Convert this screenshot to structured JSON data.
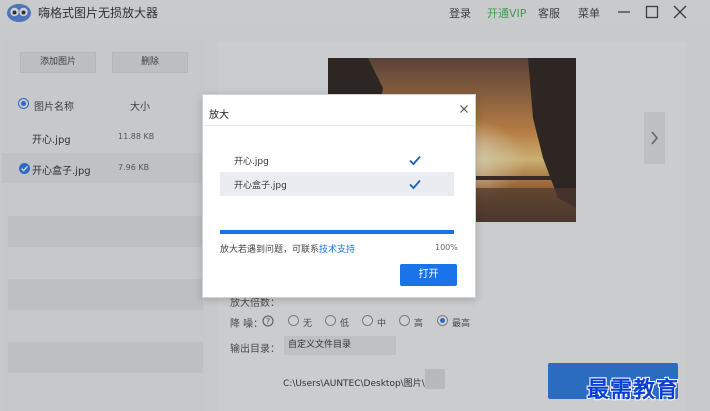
{
  "app": {
    "title": "嗨格式图片无损放大器",
    "nav": {
      "login": "登录",
      "vip": "开通VIP",
      "service": "客服",
      "menu": "菜单"
    }
  },
  "sidebar": {
    "add_button": "添加图片",
    "delete_button": "删除",
    "columns": {
      "name": "图片名称",
      "size": "大小"
    },
    "files": [
      {
        "name": "开心.jpg",
        "size": "11.88 KB",
        "checked": false
      },
      {
        "name": "开心盒子.jpg",
        "size": "7.96 KB",
        "checked": true
      }
    ]
  },
  "settings": {
    "scale_label": "放大倍数：",
    "denoise_label": "降 噪：",
    "denoise_options": [
      "无",
      "低",
      "中",
      "高",
      "最高"
    ],
    "denoise_selected": "最高",
    "output_label": "输出目录：",
    "output_value": "自定义文件目录",
    "output_path": "C:\\Users\\AUNTEC\\Desktop\\图片\\"
  },
  "dialog": {
    "title": "放大",
    "files": [
      "开心.jpg",
      "开心盒子.jpg"
    ],
    "progress_percent": 100,
    "progress_text": "100%",
    "message": "放大若遇到问题，可联系",
    "support_link": "技术支持",
    "open_button": "打开"
  },
  "watermark": "最需教育",
  "colors": {
    "accent": "#1a73e8",
    "vip": "#39b54a"
  }
}
